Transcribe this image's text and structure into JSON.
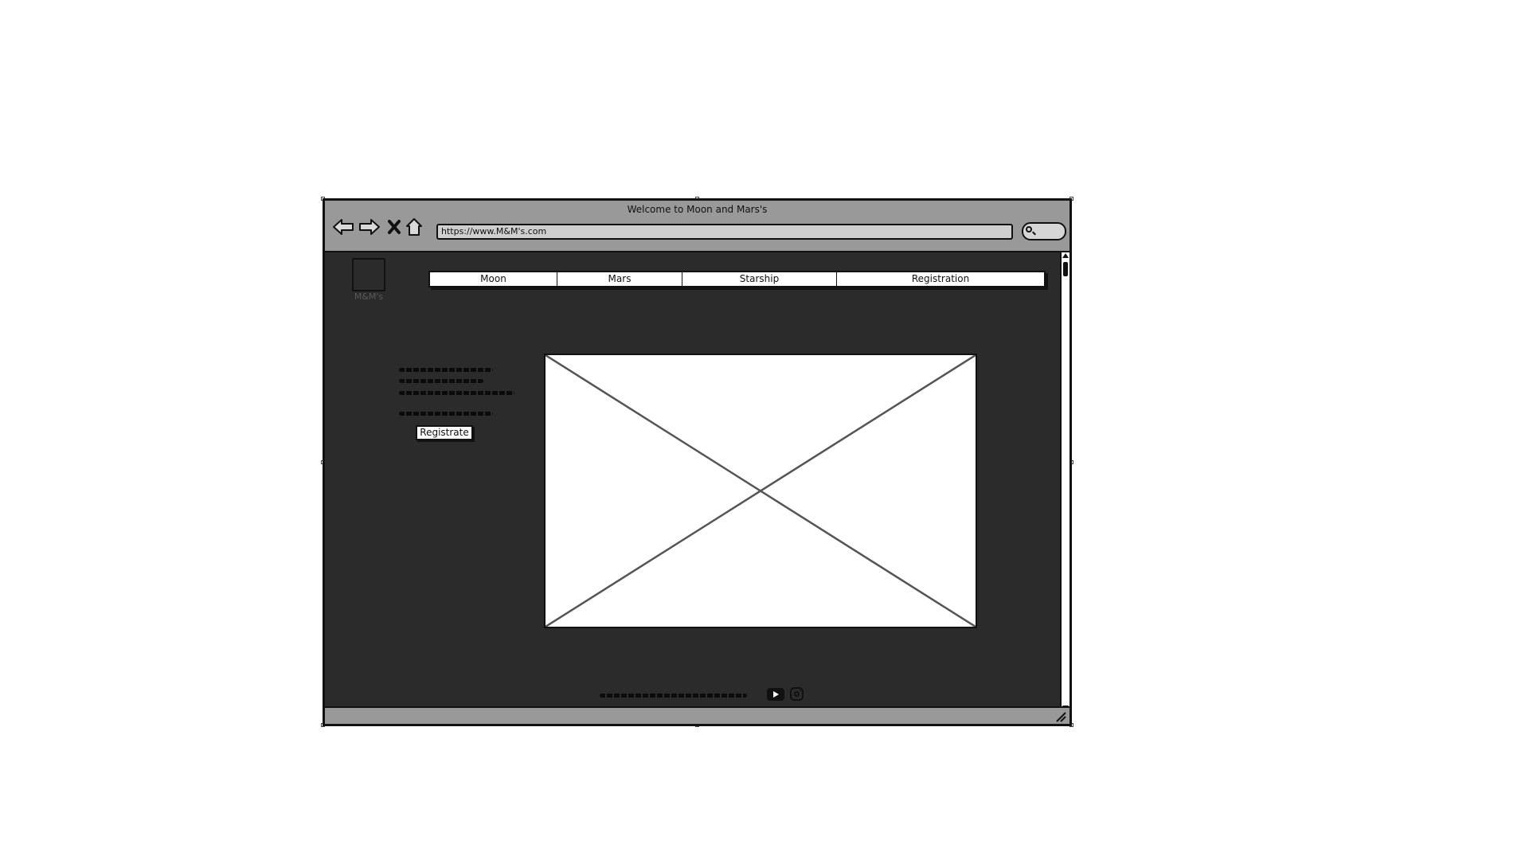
{
  "window": {
    "title": "Welcome to Moon and Mars's",
    "url": "https://www.M&M's.com"
  },
  "toolbar": {
    "icons": [
      "back-arrow-icon",
      "forward-arrow-icon",
      "close-icon",
      "home-icon",
      "search-icon"
    ]
  },
  "logo": {
    "label": "M&M's"
  },
  "menu": {
    "items": [
      {
        "label": "Moon"
      },
      {
        "label": "Mars"
      },
      {
        "label": "Starship"
      },
      {
        "label": "Registration"
      }
    ]
  },
  "hero": {
    "button_label": "Registrate",
    "image_placeholder": "image-placeholder"
  },
  "footer": {
    "icons": [
      "youtube-icon",
      "instagram-icon"
    ]
  },
  "colors": {
    "chrome": "#999999",
    "page_background": "#2b2b2b",
    "accent": "#111111"
  }
}
